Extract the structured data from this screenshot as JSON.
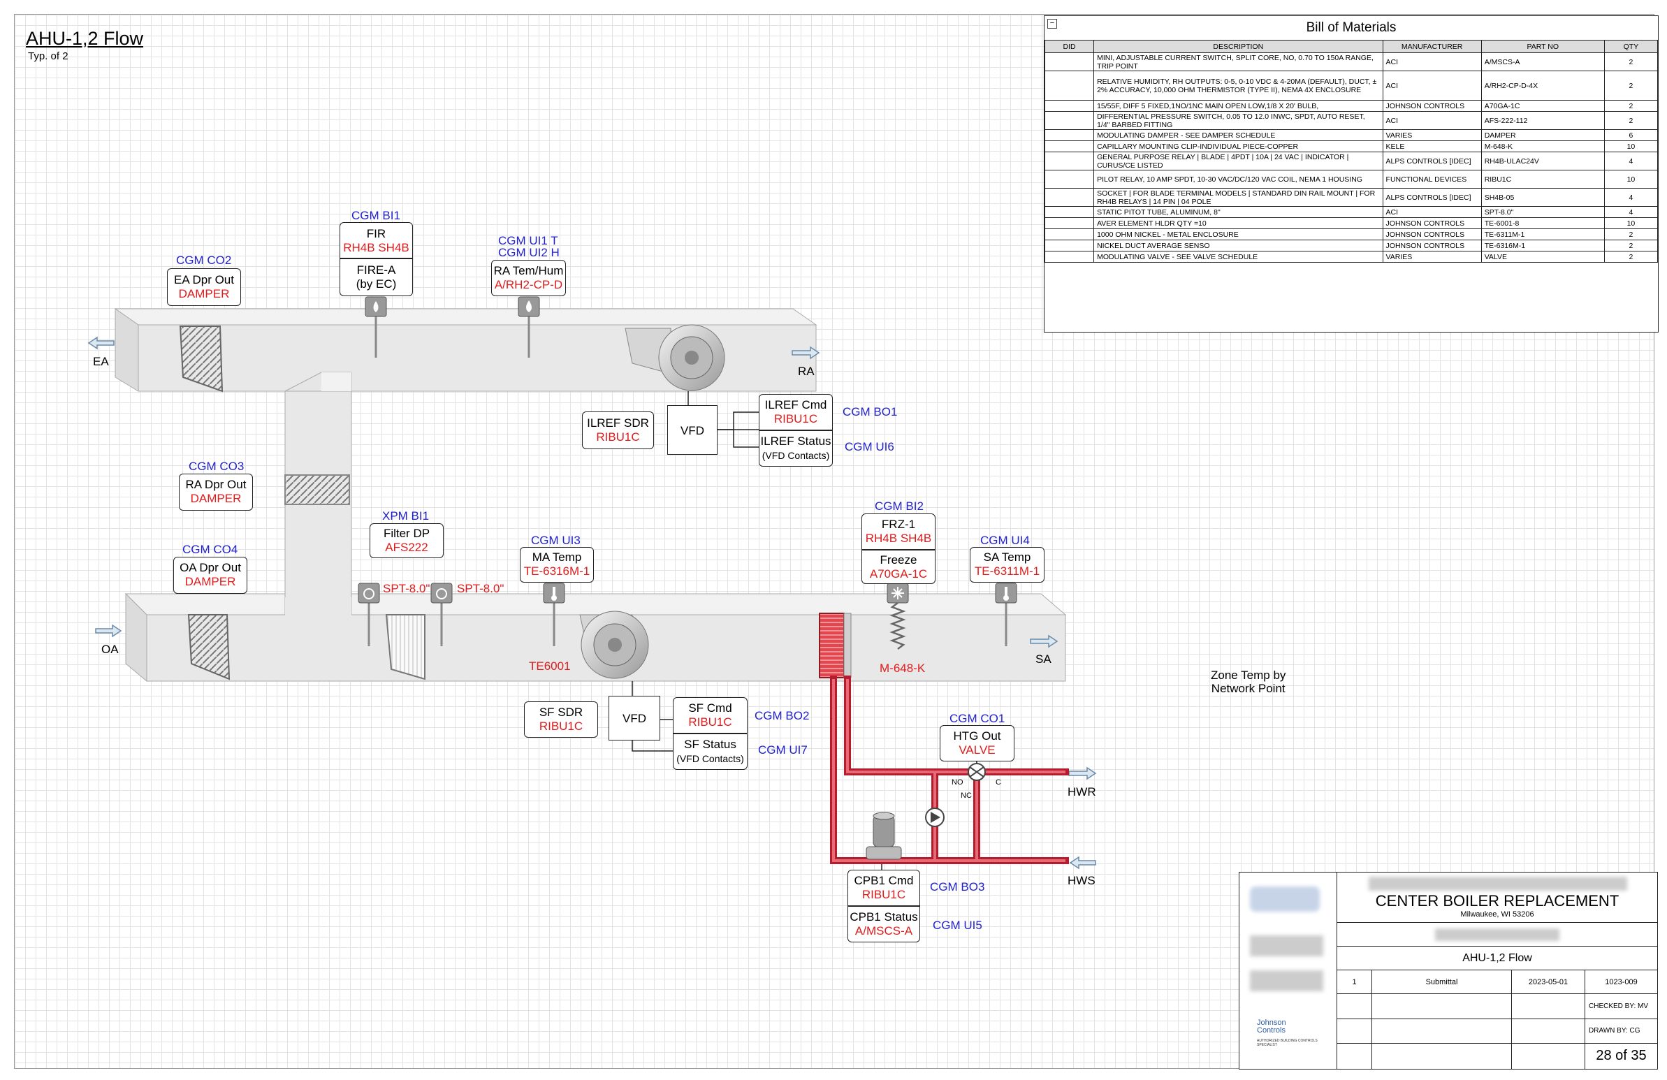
{
  "title": "AHU-1,2 Flow",
  "subtitle": "Typ. of 2",
  "bom": {
    "title": "Bill of Materials",
    "collapse_icon": "minus-box-icon",
    "headers": [
      "DID",
      "DESCRIPTION",
      "MANUFACTURER",
      "PART NO",
      "QTY"
    ],
    "rows": [
      {
        "did": "",
        "desc": "MINI, ADJUSTABLE CURRENT SWITCH, SPLIT CORE, NO, 0.70 TO 150A RANGE, TRIP POINT",
        "mfr": "ACI",
        "part": "A/MSCS-A",
        "qty": "2"
      },
      {
        "did": "",
        "desc": "RELATIVE HUMIDITY, RH OUTPUTS: 0-5, 0-10 VDC & 4-20MA (DEFAULT), DUCT, ± 2% ACCURACY, 10,000 OHM THERMISTOR (TYPE II), NEMA 4X ENCLOSURE",
        "mfr": "ACI",
        "part": "A/RH2-CP-D-4X",
        "qty": "2"
      },
      {
        "did": "",
        "desc": "15/55F, DIFF 5 FIXED,1NO/1NC MAIN OPEN LOW,1/8 X 20' BULB,",
        "mfr": "JOHNSON CONTROLS",
        "part": "A70GA-1C",
        "qty": "2"
      },
      {
        "did": "",
        "desc": "DIFFERENTIAL PRESSURE SWITCH, 0.05 TO 12.0 INWC, SPDT, AUTO RESET, 1/4\" BARBED FITTING",
        "mfr": "ACI",
        "part": "AFS-222-112",
        "qty": "2"
      },
      {
        "did": "",
        "desc": "MODULATING DAMPER - SEE DAMPER SCHEDULE",
        "mfr": "VARIES",
        "part": "DAMPER",
        "qty": "6"
      },
      {
        "did": "",
        "desc": "CAPILLARY MOUNTING CLIP-INDIVIDUAL PIECE-COPPER",
        "mfr": "KELE",
        "part": "M-648-K",
        "qty": "10"
      },
      {
        "did": "",
        "desc": "GENERAL PURPOSE RELAY | BLADE | 4PDT | 10A | 24 VAC | INDICATOR | CURUS/CE LISTED",
        "mfr": "ALPS CONTROLS [IDEC]",
        "part": "RH4B-ULAC24V",
        "qty": "4"
      },
      {
        "did": "",
        "desc": "PILOT RELAY, 10 AMP SPDT, 10-30 VAC/DC/120 VAC COIL, NEMA 1 HOUSING",
        "mfr": "FUNCTIONAL DEVICES",
        "part": "RIBU1C",
        "qty": "10"
      },
      {
        "did": "",
        "desc": "SOCKET | FOR BLADE TERMINAL MODELS | STANDARD DIN RAIL MOUNT | FOR RH4B RELAYS | 14 PIN | 04 POLE",
        "mfr": "ALPS CONTROLS [IDEC]",
        "part": "SH4B-05",
        "qty": "4"
      },
      {
        "did": "",
        "desc": "STATIC PITOT TUBE, ALUMINUM, 8\"",
        "mfr": "ACI",
        "part": "SPT-8.0\"",
        "qty": "4"
      },
      {
        "did": "",
        "desc": "AVER ELEMENT HLDR QTY =10",
        "mfr": "JOHNSON CONTROLS",
        "part": "TE-6001-8",
        "qty": "10"
      },
      {
        "did": "",
        "desc": "1000 OHM NICKEL - METAL ENCLOSURE",
        "mfr": "JOHNSON CONTROLS",
        "part": "TE-6311M-1",
        "qty": "2"
      },
      {
        "did": "",
        "desc": "NICKEL DUCT AVERAGE SENSO",
        "mfr": "JOHNSON CONTROLS",
        "part": "TE-6316M-1",
        "qty": "2"
      },
      {
        "did": "",
        "desc": "MODULATING VALVE - SEE VALVE SCHEDULE",
        "mfr": "VARIES",
        "part": "VALVE",
        "qty": "2"
      }
    ]
  },
  "tags": {
    "co2": "CGM CO2",
    "bi1": "CGM BI1",
    "ui1t": "CGM UI1 T",
    "ui2h": "CGM UI2 H",
    "co3": "CGM CO3",
    "co4": "CGM CO4",
    "xpmbi1": "XPM BI1",
    "ui3": "CGM UI3",
    "bi2": "CGM BI2",
    "ui4": "CGM UI4",
    "bo1": "CGM BO1",
    "ui6": "CGM UI6",
    "bo2": "CGM BO2",
    "ui7": "CGM UI7",
    "co1": "CGM CO1",
    "bo3": "CGM BO3",
    "ui5": "CGM UI5"
  },
  "boxes": {
    "ea_dpr": {
      "l1": "EA Dpr Out",
      "l2": "DAMPER"
    },
    "fir": {
      "l1": "FIR",
      "l2a": "RH4B",
      "l2b": "SH4B",
      "l3": "FIRE-A",
      "l4": "(by EC)"
    },
    "ra_temhum": {
      "l1": "RA Tem/Hum",
      "l2": "A/RH2-CP-D"
    },
    "ra_dpr": {
      "l1": "RA Dpr Out",
      "l2": "DAMPER"
    },
    "oa_dpr": {
      "l1": "OA Dpr Out",
      "l2": "DAMPER"
    },
    "filter_dp": {
      "l1": "Filter DP",
      "l2": "AFS222"
    },
    "ma_temp": {
      "l1": "MA Temp",
      "l2": "TE-6316M-1"
    },
    "frz": {
      "l1": "FRZ-1",
      "l2a": "RH4B",
      "l2b": "SH4B",
      "l3": "Freeze",
      "l4": "A70GA-1C"
    },
    "sa_temp": {
      "l1": "SA Temp",
      "l2": "TE-6311M-1"
    },
    "ilref_sdr": {
      "l1": "ILREF SDR",
      "l2": "RIBU1C"
    },
    "vfd1": "VFD",
    "ilref_cmd": {
      "l1": "ILREF Cmd",
      "l2": "RIBU1C"
    },
    "ilref_status": {
      "l1": "ILREF Status",
      "l2": "(VFD Contacts)"
    },
    "sf_sdr": {
      "l1": "SF SDR",
      "l2": "RIBU1C"
    },
    "vfd2": "VFD",
    "sf_cmd": {
      "l1": "SF Cmd",
      "l2": "RIBU1C"
    },
    "sf_status": {
      "l1": "SF Status",
      "l2": "(VFD Contacts)"
    },
    "htg_out": {
      "l1": "HTG Out",
      "l2": "VALVE"
    },
    "cpb1_cmd": {
      "l1": "CPB1 Cmd",
      "l2": "RIBU1C"
    },
    "cpb1_status": {
      "l1": "CPB1 Status",
      "l2": "A/MSCS-A"
    }
  },
  "labels": {
    "ea": "EA",
    "ra": "RA",
    "oa": "OA",
    "sa": "SA",
    "hwr": "HWR",
    "hws": "HWS",
    "spt1": "SPT-8.0\"",
    "spt2": "SPT-8.0\"",
    "te6001": "TE6001",
    "m648k": "M-648-K",
    "no": "NO",
    "nc": "NC",
    "c": "C",
    "zone1": "Zone Temp by",
    "zone2": "Network Point"
  },
  "colors": {
    "tag_blue": "#2222cc",
    "part_red": "#e01b1b",
    "pipe_red": "#d9364a",
    "duct_gray": "#e6e6e6"
  },
  "titleblock": {
    "project": "CENTER BOILER REPLACEMENT",
    "location": "Milwaukee, WI 53206",
    "drawing": "AHU-1,2 Flow",
    "rev": "1",
    "desc": "Submittal",
    "date": "2023-05-01",
    "job": "1023-009",
    "checked": "CHECKED BY: MV",
    "drawn": "DRAWN BY: CG",
    "sheet": "28 of 35",
    "logo_line1": "Johnson",
    "logo_line2": "Controls",
    "logo_tagline": "AUTHORIZED BUILDING CONTROLS SPECIALIST"
  }
}
